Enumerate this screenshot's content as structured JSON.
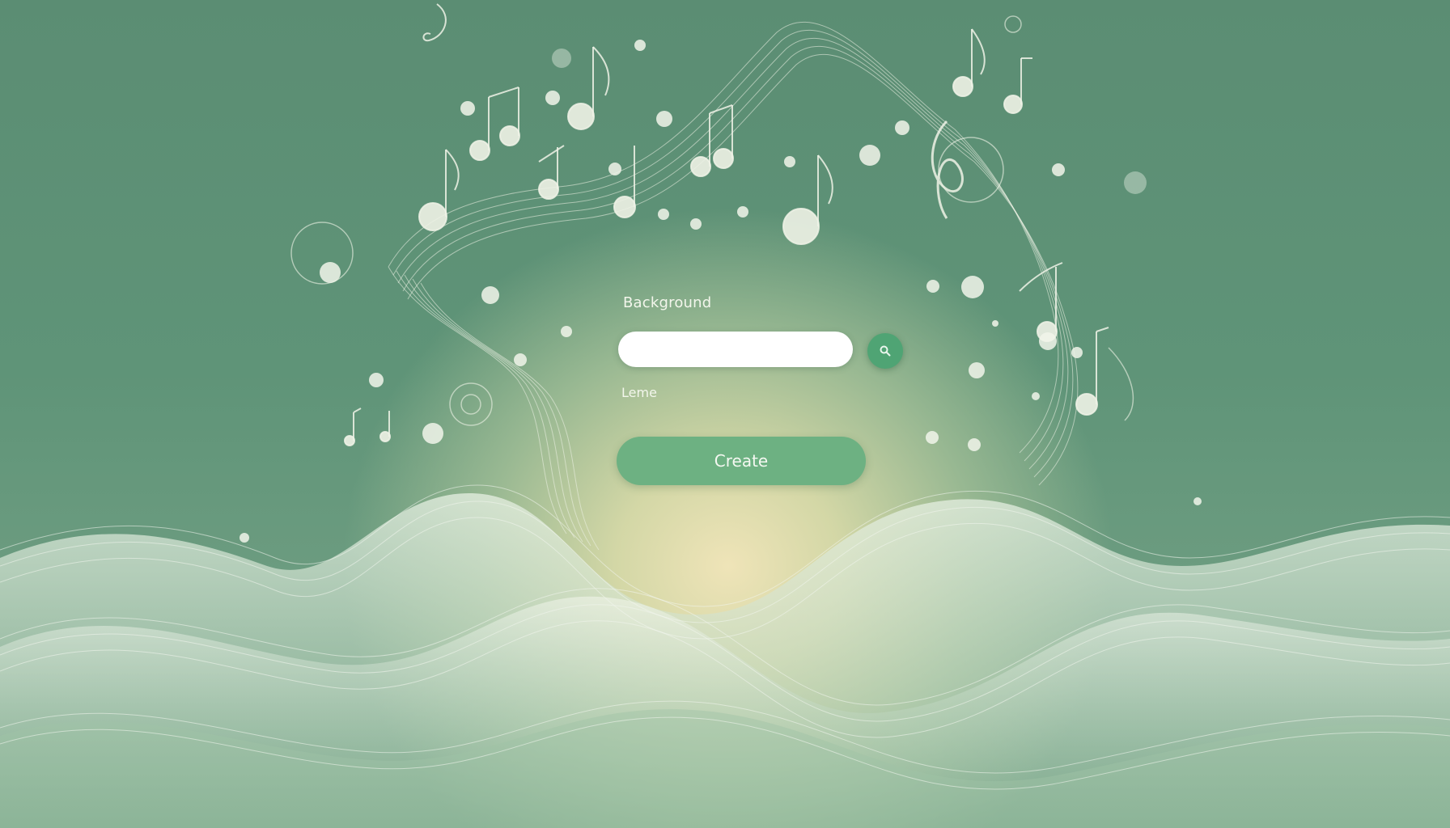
{
  "form": {
    "field_label": "Background",
    "input_value": "",
    "input_placeholder": "",
    "secondary_label": "Leme",
    "create_label": "Create",
    "search_icon": "search-icon"
  },
  "colors": {
    "background_green": "#5f9478",
    "glow_cream": "#efe4b8",
    "button_green": "#6db182",
    "search_button_green": "#4fa474",
    "input_white": "#ffffff"
  }
}
